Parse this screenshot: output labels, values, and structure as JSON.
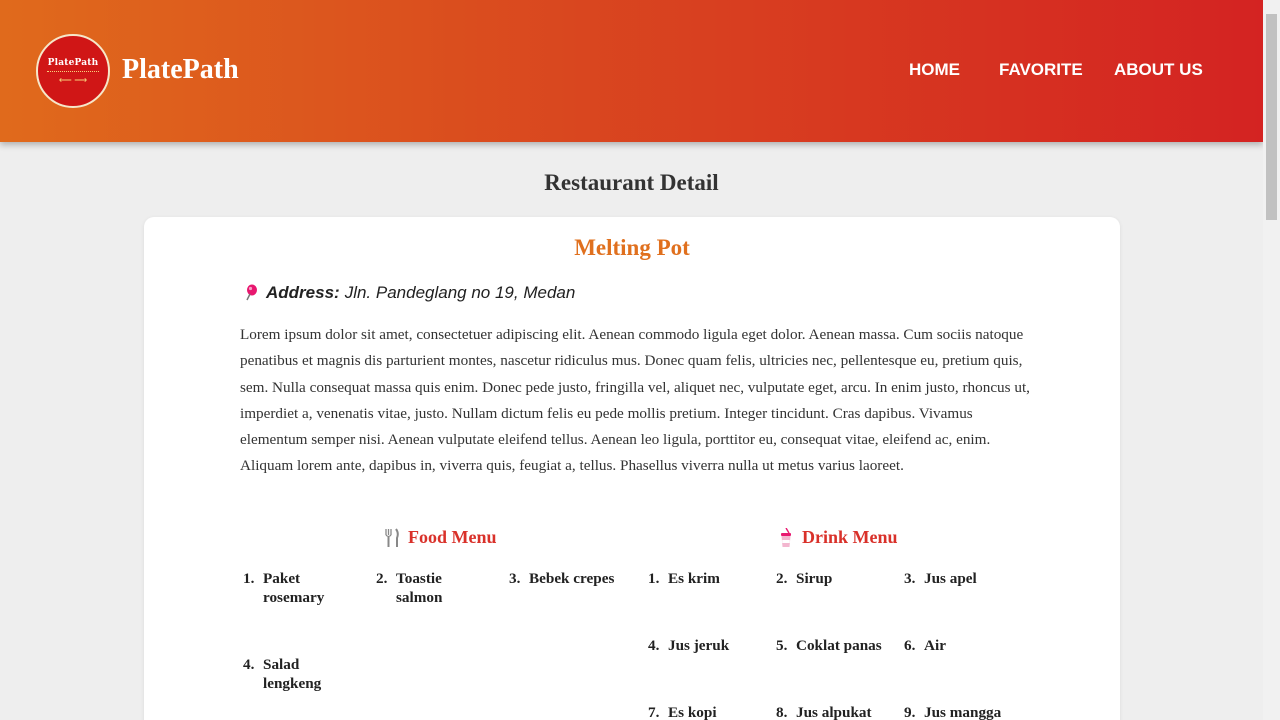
{
  "brand": {
    "name": "PlatePath",
    "logo_text": "PlatePath"
  },
  "nav": {
    "items": [
      "HOME",
      "FAVORITE",
      "ABOUT US"
    ]
  },
  "page": {
    "title": "Restaurant Detail"
  },
  "restaurant": {
    "name": "Melting Pot",
    "address_label": "Address:",
    "address": "Jln. Pandeglang no 19, Medan",
    "description": "Lorem ipsum dolor sit amet, consectetuer adipiscing elit. Aenean commodo ligula eget dolor. Aenean massa. Cum sociis natoque penatibus et magnis dis parturient montes, nascetur ridiculus mus. Donec quam felis, ultricies nec, pellentesque eu, pretium quis, sem. Nulla consequat massa quis enim. Donec pede justo, fringilla vel, aliquet nec, vulputate eget, arcu. In enim justo, rhoncus ut, imperdiet a, venenatis vitae, justo. Nullam dictum felis eu pede mollis pretium. Integer tincidunt. Cras dapibus. Vivamus elementum semper nisi. Aenean vulputate eleifend tellus. Aenean leo ligula, porttitor eu, consequat vitae, eleifend ac, enim. Aliquam lorem ante, dapibus in, viverra quis, feugiat a, tellus. Phasellus viverra nulla ut metus varius laoreet."
  },
  "food_menu": {
    "title": "Food Menu",
    "icon": "fork-knife-icon",
    "items": [
      {
        "num": "1.",
        "name": "Paket rosemary"
      },
      {
        "num": "2.",
        "name": "Toastie salmon"
      },
      {
        "num": "3.",
        "name": "Bebek crepes"
      },
      {
        "num": "4.",
        "name": "Salad lengkeng"
      }
    ]
  },
  "drink_menu": {
    "title": "Drink Menu",
    "icon": "drink-cup-icon",
    "items": [
      {
        "num": "1.",
        "name": "Es krim"
      },
      {
        "num": "2.",
        "name": "Sirup"
      },
      {
        "num": "3.",
        "name": "Jus apel"
      },
      {
        "num": "4.",
        "name": "Jus jeruk"
      },
      {
        "num": "5.",
        "name": "Coklat panas"
      },
      {
        "num": "6.",
        "name": "Air"
      },
      {
        "num": "7.",
        "name": "Es kopi"
      },
      {
        "num": "8.",
        "name": "Jus alpukat"
      },
      {
        "num": "9.",
        "name": "Jus mangga"
      }
    ]
  },
  "colors": {
    "header_start": "#e06a1c",
    "header_end": "#d42322",
    "accent": "#e0701e",
    "menu_title": "#d9312a"
  }
}
